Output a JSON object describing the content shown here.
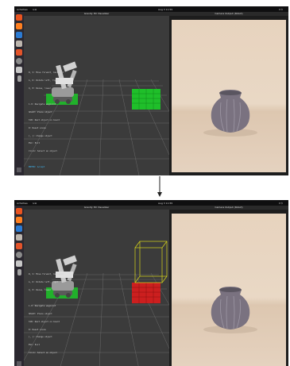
{
  "top_screen": {
    "topbar": {
      "activities": "Activities",
      "app": "rviz",
      "clock": "Aug 3 11:55"
    },
    "viz_title": "Gravity 3D Visualizer",
    "cam_title": "Camera Output (Robot)",
    "help_lines": [
      "W, S: Move forward, backward",
      "A, D: Rotate left, right",
      "Q, E: Raise, lower",
      "",
      "1-9: Navigate waypoint",
      "SPACE: Place object",
      "TAB: Next object on board",
      "R: Reset scene",
      "[, ]: Change object",
      "ESC: Exit",
      "Click: Select an object",
      "",
      "ENTER: Accept"
    ]
  },
  "bottom_screen": {
    "topbar": {
      "activities": "Activities",
      "app": "rviz",
      "clock": "Aug 3 11:55"
    },
    "viz_title": "Gravity 3D Visualizer",
    "cam_title": "Camera Output (Robot)",
    "help_lines": [
      "W, S: Move forward, backward",
      "A, D: Rotate left, right",
      "Q, E: Raise, lower",
      "",
      "1-9: Navigate waypoint",
      "SPACE: Place object",
      "TAB: Next object on board",
      "R: Reset scene",
      "[, ]: Change object",
      "ESC: Exit",
      "Click: Select an object",
      ""
    ]
  },
  "colors": {
    "placement_before": "#1fbf2a",
    "placement_after": "#cc1f1f",
    "bounding_box": "#d8d61a",
    "viz_background": "#3b3b3b",
    "wall": "#e7d3be"
  },
  "icons": [
    "ubuntu-logo-icon",
    "firefox-icon",
    "vscode-icon",
    "files-icon",
    "software-center-icon",
    "settings-icon",
    "terminal-icon",
    "trash-icon",
    "app-grid-icon"
  ]
}
